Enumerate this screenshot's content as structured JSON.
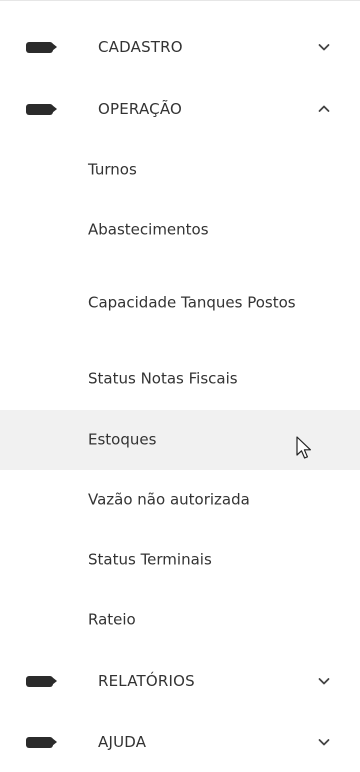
{
  "menu": {
    "sections": [
      {
        "label": "CADASTRO",
        "icon": "label-tag-icon",
        "expanded": false,
        "chevron": "chevron-down-icon"
      },
      {
        "label": "OPERAÇÃO",
        "icon": "label-tag-icon",
        "expanded": true,
        "chevron": "chevron-up-icon"
      },
      {
        "label": "RELATÓRIOS",
        "icon": "label-tag-icon",
        "expanded": false,
        "chevron": "chevron-down-icon"
      },
      {
        "label": "AJUDA",
        "icon": "label-tag-icon",
        "expanded": false,
        "chevron": "chevron-down-icon"
      }
    ],
    "operacao_items": [
      "Turnos",
      "Abastecimentos",
      "Capacidade Tanques Postos",
      "Status Notas Fiscais",
      "Estoques",
      "Vazão não autorizada",
      "Status Terminais",
      "Rateio"
    ],
    "hovered_item": "Estoques"
  },
  "colors": {
    "text": "#333333",
    "icon": "#2b2b2b",
    "hover_background": "#f1f1f1",
    "divider": "#e6e6e6"
  }
}
